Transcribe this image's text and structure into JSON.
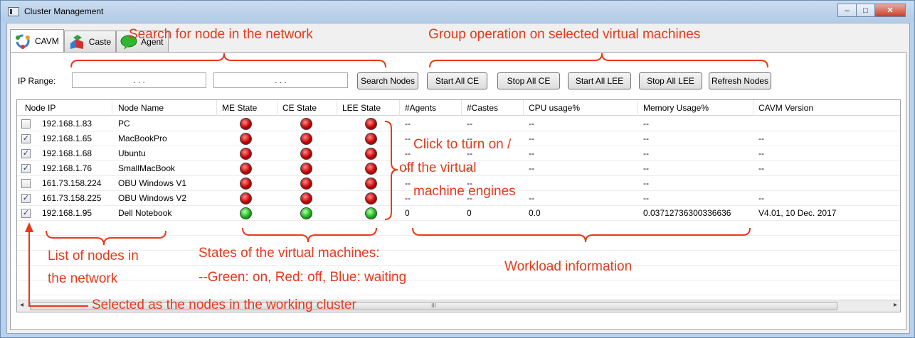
{
  "window": {
    "title": "Cluster Management",
    "minimize": "–",
    "maximize": "□",
    "close": "✕"
  },
  "tabs": [
    {
      "label": "CAVM",
      "icon": "cavm-icon",
      "active": true
    },
    {
      "label": "Caste",
      "icon": "caste-icon",
      "active": false
    },
    {
      "label": "Agent",
      "icon": "agent-icon",
      "active": false
    }
  ],
  "ip_range": {
    "label": "IP Range:",
    "from": ".       .       .",
    "to": ".       .       ."
  },
  "buttons": {
    "search": "Search Nodes",
    "start_ce": "Start All CE",
    "stop_ce": "Stop All CE",
    "start_lee": "Start All LEE",
    "stop_lee": "Stop All LEE",
    "refresh": "Refresh Nodes"
  },
  "table": {
    "columns": [
      "Node IP",
      "Node Name",
      "ME State",
      "CE State",
      "LEE State",
      "#Agents",
      "#Castes",
      "CPU usage%",
      "Memory Usage%",
      "CAVM Version"
    ],
    "rows": [
      {
        "checked": false,
        "ip": "192.168.1.83",
        "name": "PC",
        "me": "red",
        "ce": "red",
        "lee": "red",
        "agents": "--",
        "castes": "--",
        "cpu": "--",
        "mem": "--",
        "ver": ""
      },
      {
        "checked": true,
        "ip": "192.168.1.65",
        "name": "MacBookPro",
        "me": "red",
        "ce": "red",
        "lee": "red",
        "agents": "--",
        "castes": "--",
        "cpu": "--",
        "mem": "--",
        "ver": "--"
      },
      {
        "checked": true,
        "ip": "192.168.1.68",
        "name": "Ubuntu",
        "me": "red",
        "ce": "red",
        "lee": "red",
        "agents": "--",
        "castes": "--",
        "cpu": "--",
        "mem": "--",
        "ver": "--"
      },
      {
        "checked": true,
        "ip": "192.168.1.76",
        "name": "SmallMacBook",
        "me": "red",
        "ce": "red",
        "lee": "red",
        "agents": "--",
        "castes": "--",
        "cpu": "--",
        "mem": "--",
        "ver": "--"
      },
      {
        "checked": false,
        "ip": "161.73.158.224",
        "name": "OBU Windows V1",
        "me": "red",
        "ce": "red",
        "lee": "red",
        "agents": "--",
        "castes": "--",
        "cpu": "",
        "mem": "--",
        "ver": ""
      },
      {
        "checked": true,
        "ip": "161.73.158.225",
        "name": "OBU Windows V2",
        "me": "red",
        "ce": "red",
        "lee": "red",
        "agents": "--",
        "castes": "--",
        "cpu": "--",
        "mem": "--",
        "ver": "--"
      },
      {
        "checked": true,
        "ip": "192.168.1.95",
        "name": "Dell Notebook",
        "me": "green",
        "ce": "green",
        "lee": "green",
        "agents": "0",
        "castes": "0",
        "cpu": "0.0",
        "mem": "0.03712736300336636",
        "ver": "V4.01, 10 Dec. 2017"
      }
    ],
    "scroll_grip": "III"
  },
  "annotations": {
    "search": "Search for node in the network",
    "group": "Group operation on selected virtual machines",
    "click": [
      "Click to turn on /",
      "off the virtual",
      "machine engines"
    ],
    "list": [
      "List of nodes in",
      "the network"
    ],
    "states": [
      "States of the virtual machines:",
      "--Green: on, Red: off, Blue: waiting"
    ],
    "workload": "Workload information",
    "selected": "Selected as the nodes in the working cluster"
  },
  "colors": {
    "annotation": "#e8391b",
    "led_on": "#18b418",
    "led_off": "#c40000"
  }
}
